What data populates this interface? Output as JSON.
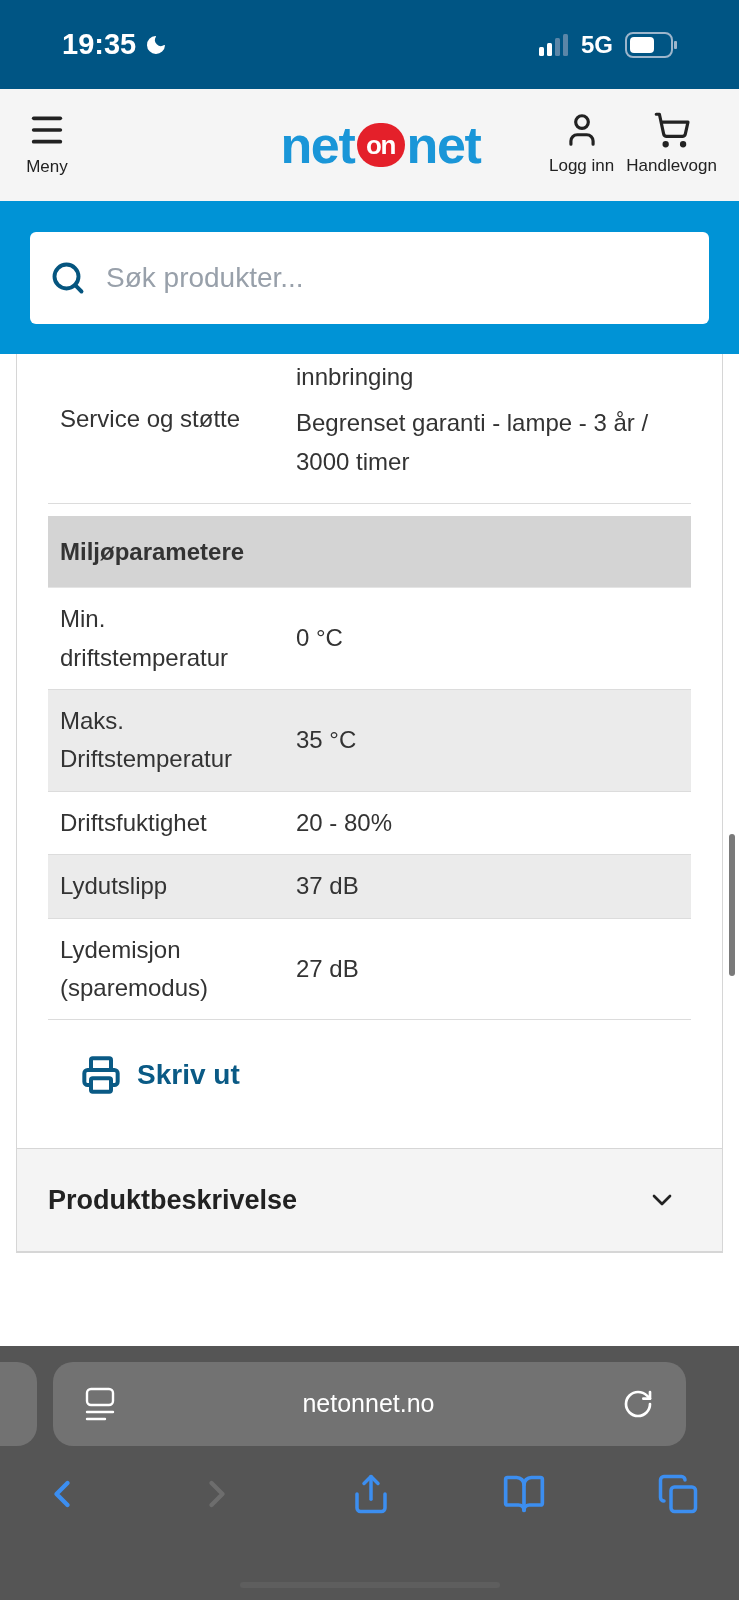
{
  "status_bar": {
    "time": "19:35",
    "network": "5G"
  },
  "header": {
    "menu_label": "Meny",
    "logo": {
      "left": "net",
      "badge": "on",
      "right": "net"
    },
    "login_label": "Logg inn",
    "cart_label": "Handlevogn"
  },
  "search": {
    "placeholder": "Søk produkter..."
  },
  "spec_table": {
    "rows": [
      {
        "kind": "row",
        "label": "Service og støtte",
        "values": [
          "innbringing",
          "Begrenset garanti - lampe - 3 år / 3000 timer"
        ]
      },
      {
        "kind": "section",
        "label": "Miljøparametere"
      },
      {
        "kind": "row",
        "label": "Min. driftstemperatur",
        "values": [
          "0 °C"
        ]
      },
      {
        "kind": "row",
        "label": "Maks. Driftstemperatur",
        "values": [
          "35 °C"
        ]
      },
      {
        "kind": "row",
        "label": "Driftsfuktighet",
        "values": [
          "20 - 80%"
        ]
      },
      {
        "kind": "row",
        "label": "Lydutslipp",
        "values": [
          "37 dB"
        ]
      },
      {
        "kind": "row",
        "label": "Lydemisjon (sparemodus)",
        "values": [
          "27 dB"
        ]
      }
    ]
  },
  "print_link": "Skriv ut",
  "accordion": {
    "title": "Produktbeskrivelse",
    "expanded": false
  },
  "browser": {
    "url": "netonnet.no"
  }
}
